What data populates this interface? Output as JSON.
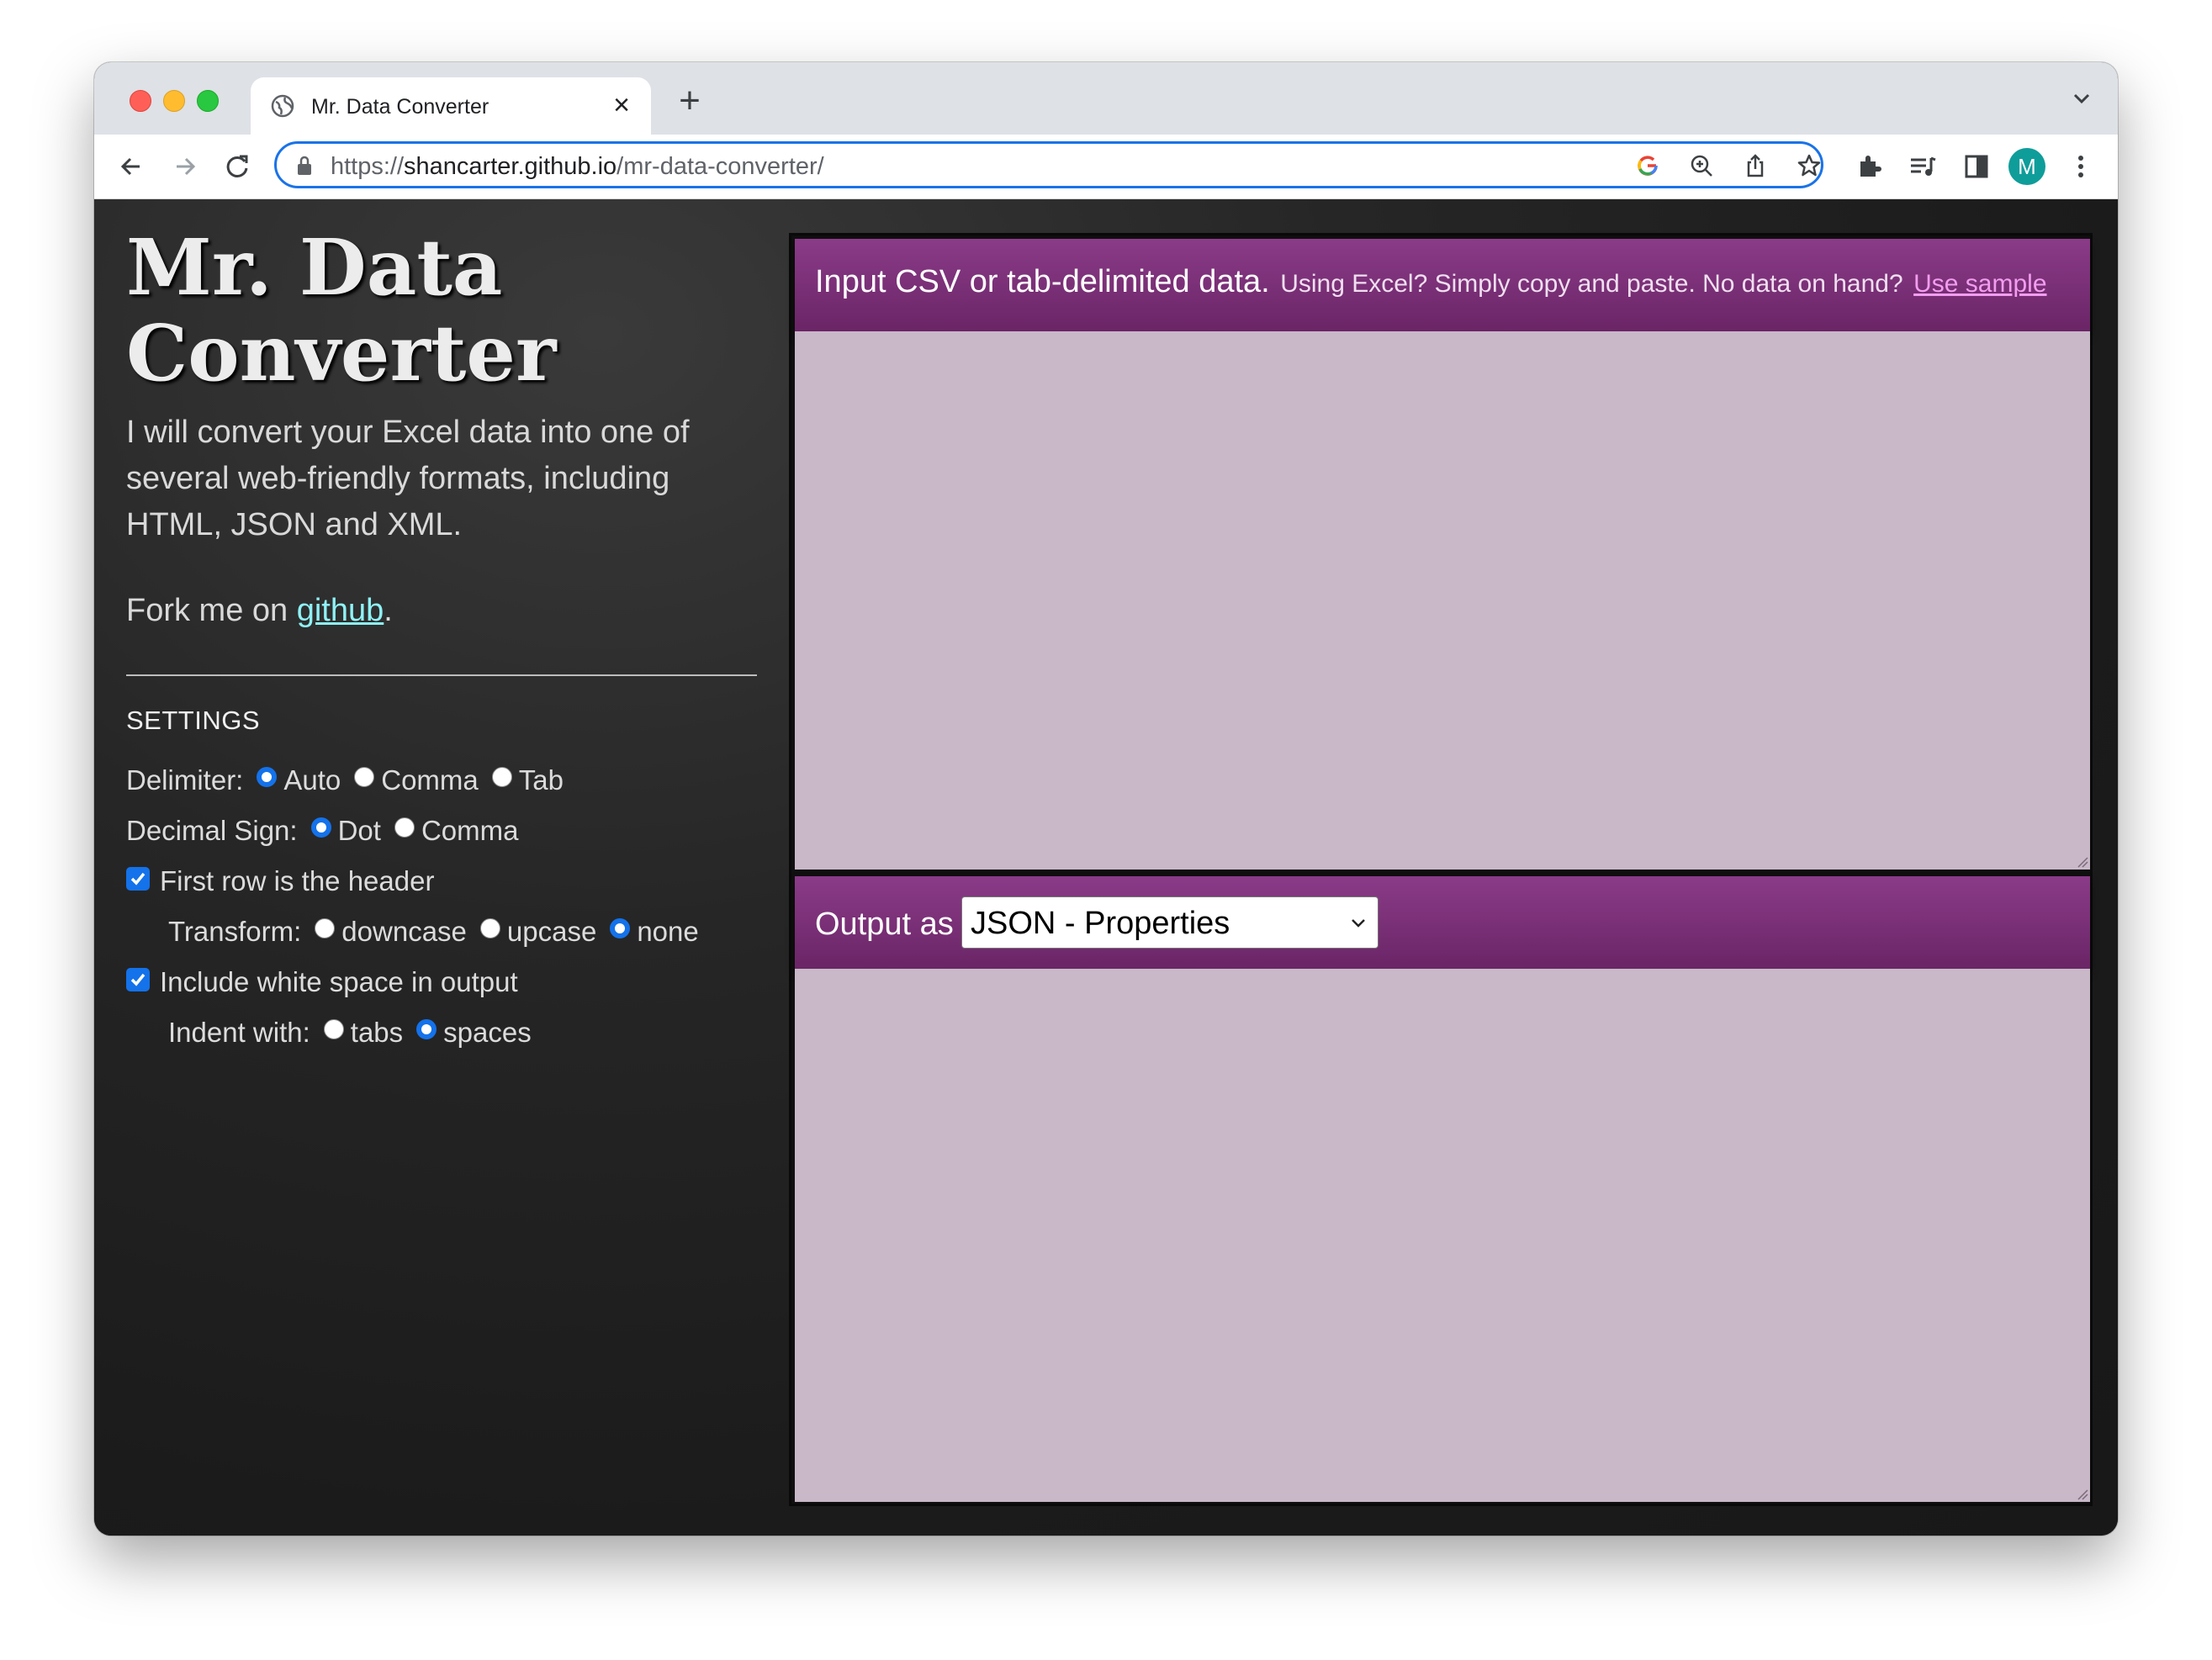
{
  "browser": {
    "tab_title": "Mr. Data Converter",
    "url_scheme": "https://",
    "url_host": "shancarter.github.io",
    "url_path": "/mr-data-converter/",
    "profile_initial": "M"
  },
  "sidebar": {
    "title_line1": "Mr. Data",
    "title_line2": "Converter",
    "intro": "I will convert your Excel data into one of several web-friendly formats, including HTML, JSON and XML.",
    "fork_prefix": "Fork me on ",
    "fork_link": "github",
    "fork_suffix": ".",
    "settings_heading": "SETTINGS",
    "delimiter": {
      "label": "Delimiter:",
      "options": [
        "Auto",
        "Comma",
        "Tab"
      ],
      "selected": "Auto"
    },
    "decimal": {
      "label": "Decimal Sign:",
      "options": [
        "Dot",
        "Comma"
      ],
      "selected": "Dot"
    },
    "header_row": {
      "label": "First row is the header",
      "checked": true
    },
    "transform": {
      "label": "Transform:",
      "options": [
        "downcase",
        "upcase",
        "none"
      ],
      "selected": "none"
    },
    "whitespace": {
      "label": "Include white space in output",
      "checked": true
    },
    "indent": {
      "label": "Indent with:",
      "options": [
        "tabs",
        "spaces"
      ],
      "selected": "spaces"
    }
  },
  "input_panel": {
    "heading": "Input CSV or tab-delimited data.",
    "hint": "Using Excel? Simply copy and paste. No data on hand?",
    "sample_link": "Use sample",
    "value": ""
  },
  "output_panel": {
    "label": "Output as",
    "format_selected": "JSON - Properties",
    "value": ""
  },
  "colors": {
    "header_purple": "#7a2f77",
    "textarea_bg": "#c8b8c8",
    "link_cyan": "#8ff2f6",
    "accent_blue": "#1472ea"
  }
}
